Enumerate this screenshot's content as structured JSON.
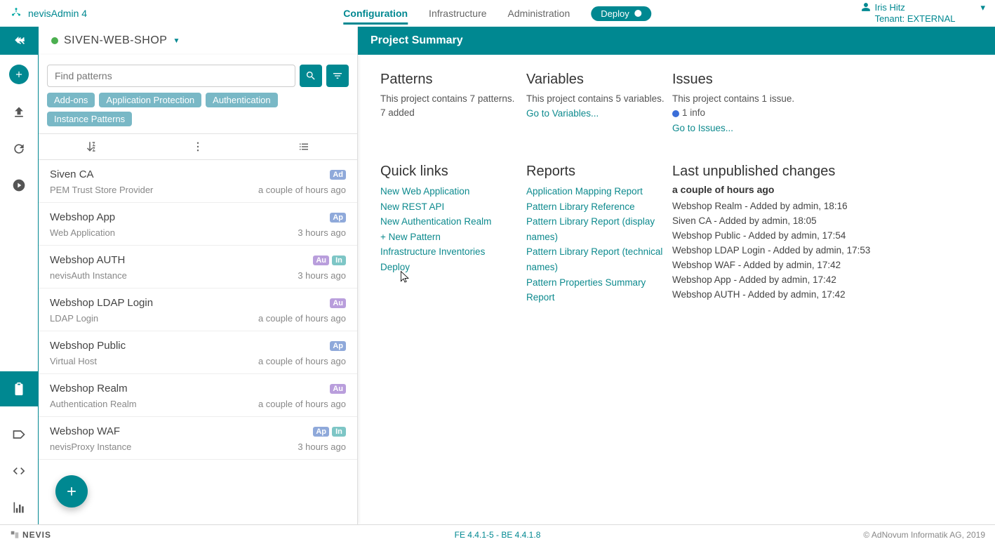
{
  "header": {
    "brand": "nevisAdmin 4",
    "nav": {
      "configuration": "Configuration",
      "infrastructure": "Infrastructure",
      "administration": "Administration",
      "deploy": "Deploy"
    },
    "user_name": "Iris Hitz",
    "tenant": "Tenant: EXTERNAL"
  },
  "project": {
    "name": "SIVEN-WEB-SHOP"
  },
  "page_title": "Project Summary",
  "search": {
    "placeholder": "Find patterns"
  },
  "chips": [
    "Add-ons",
    "Application Protection",
    "Authentication",
    "Instance Patterns"
  ],
  "patterns": [
    {
      "title": "Siven CA",
      "sub": "PEM Trust Store Provider",
      "time": "a couple of hours ago",
      "badges": [
        "Ad"
      ]
    },
    {
      "title": "Webshop App",
      "sub": "Web Application",
      "time": "3 hours ago",
      "badges": [
        "Ap"
      ]
    },
    {
      "title": "Webshop AUTH",
      "sub": "nevisAuth Instance",
      "time": "3 hours ago",
      "badges": [
        "Au",
        "In"
      ]
    },
    {
      "title": "Webshop LDAP Login",
      "sub": "LDAP Login",
      "time": "a couple of hours ago",
      "badges": [
        "Au"
      ]
    },
    {
      "title": "Webshop Public",
      "sub": "Virtual Host",
      "time": "a couple of hours ago",
      "badges": [
        "Ap"
      ]
    },
    {
      "title": "Webshop Realm",
      "sub": "Authentication Realm",
      "time": "a couple of hours ago",
      "badges": [
        "Au"
      ]
    },
    {
      "title": "Webshop WAF",
      "sub": "nevisProxy Instance",
      "time": "3 hours ago",
      "badges": [
        "Ap",
        "In"
      ]
    }
  ],
  "summary": {
    "patterns": {
      "title": "Patterns",
      "line1": "This project contains 7 patterns.",
      "line2": "7 added"
    },
    "variables": {
      "title": "Variables",
      "line1": "This project contains 5 variables.",
      "link": "Go to Variables..."
    },
    "issues": {
      "title": "Issues",
      "line1": "This project contains 1 issue.",
      "info": "1 info",
      "link": "Go to Issues..."
    },
    "quicklinks": {
      "title": "Quick links",
      "links": [
        "New Web Application",
        "New REST API",
        "New Authentication Realm",
        "+ New Pattern",
        "Infrastructure Inventories",
        "Deploy"
      ]
    },
    "reports": {
      "title": "Reports",
      "links": [
        "Application Mapping Report",
        "Pattern Library Reference",
        "Pattern Library Report (display names)",
        "Pattern Library Report (technical names)",
        "Pattern Properties Summary Report"
      ]
    },
    "changes": {
      "title": "Last unpublished changes",
      "when": "a couple of hours ago",
      "items": [
        "Webshop Realm - Added by admin, 18:16",
        "Siven CA - Added by admin, 18:05",
        "Webshop Public - Added by admin, 17:54",
        "Webshop LDAP Login - Added by admin, 17:53",
        "Webshop WAF - Added by admin, 17:42",
        "Webshop App - Added by admin, 17:42",
        "Webshop AUTH - Added by admin, 17:42"
      ]
    }
  },
  "footer": {
    "brand": "NEVIS",
    "version": "FE 4.4.1-5 - BE 4.4.1.8",
    "copyright": "© AdNovum Informatik AG, 2019"
  }
}
